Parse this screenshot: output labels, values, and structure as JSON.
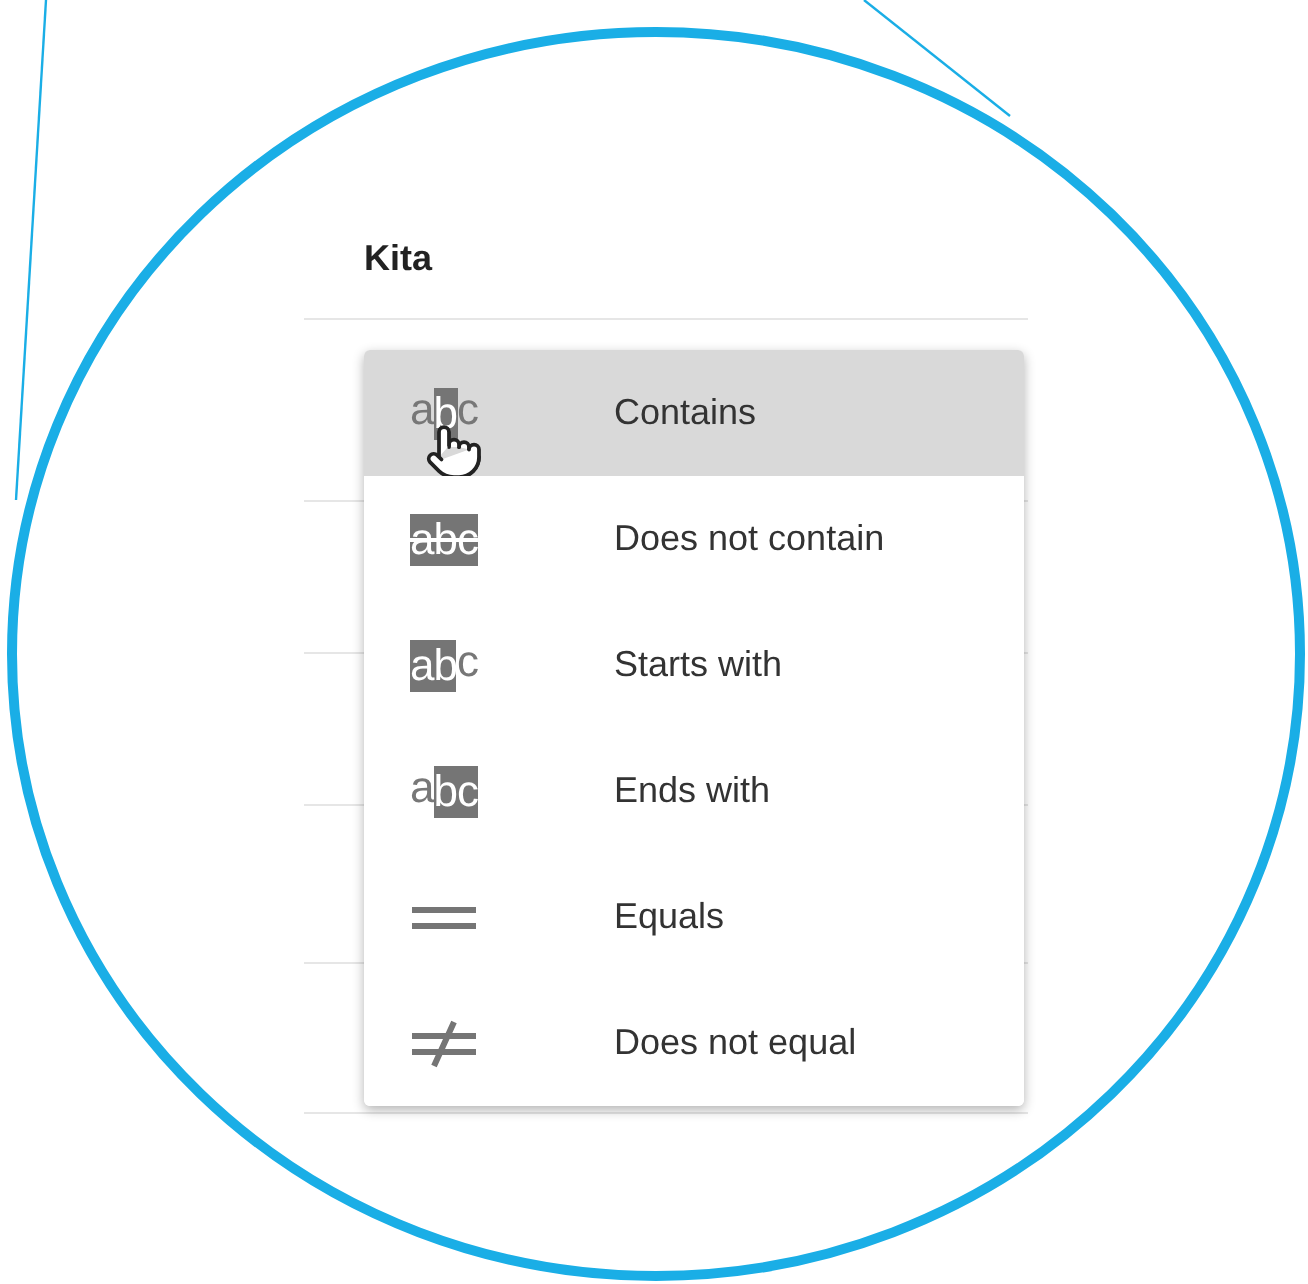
{
  "column_header": {
    "label": "Kita"
  },
  "menu": {
    "items": [
      {
        "kind": "contains",
        "icon_text": "abc",
        "label": "Contains",
        "selected": true
      },
      {
        "kind": "not_contains",
        "icon_text": "abc",
        "label": "Does not contain",
        "selected": false
      },
      {
        "kind": "starts_with",
        "icon_text": "abc",
        "label": "Starts with",
        "selected": false
      },
      {
        "kind": "ends_with",
        "icon_text": "abc",
        "label": "Ends with",
        "selected": false
      },
      {
        "kind": "equals",
        "label": "Equals",
        "selected": false
      },
      {
        "kind": "not_equals",
        "label": "Does not equal",
        "selected": false
      }
    ]
  }
}
